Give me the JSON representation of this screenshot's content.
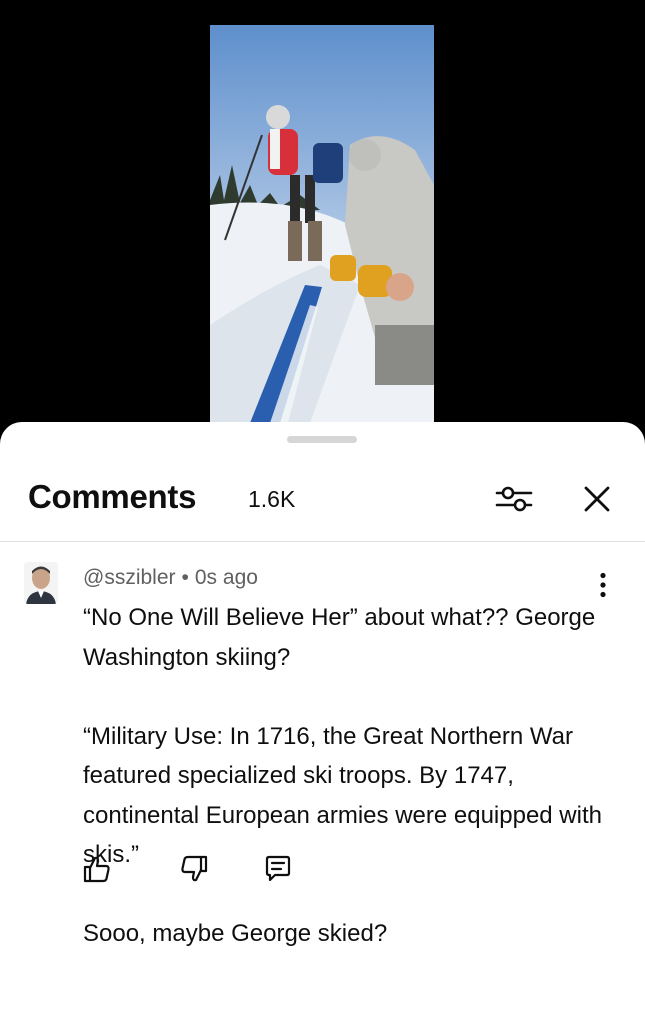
{
  "video": {
    "thumbnail_icon": "skiing-video-frame"
  },
  "comments_panel": {
    "title": "Comments",
    "count": "1.6K",
    "filter_icon": "sliders-icon",
    "close_icon": "close-icon"
  },
  "comment": {
    "author": "@sszibler",
    "separator": "•",
    "time": "0s ago",
    "paragraphs": [
      "“No One Will Believe Her” about what?? George Washington skiing?",
      "“Military Use: In 1716, the Great Northern War featured specialized ski troops. By 1747, continental European armies were equipped with skis.”",
      "Sooo, maybe George skied?"
    ],
    "actions": {
      "like_icon": "thumbs-up-icon",
      "dislike_icon": "thumbs-down-icon",
      "reply_icon": "reply-icon"
    }
  }
}
